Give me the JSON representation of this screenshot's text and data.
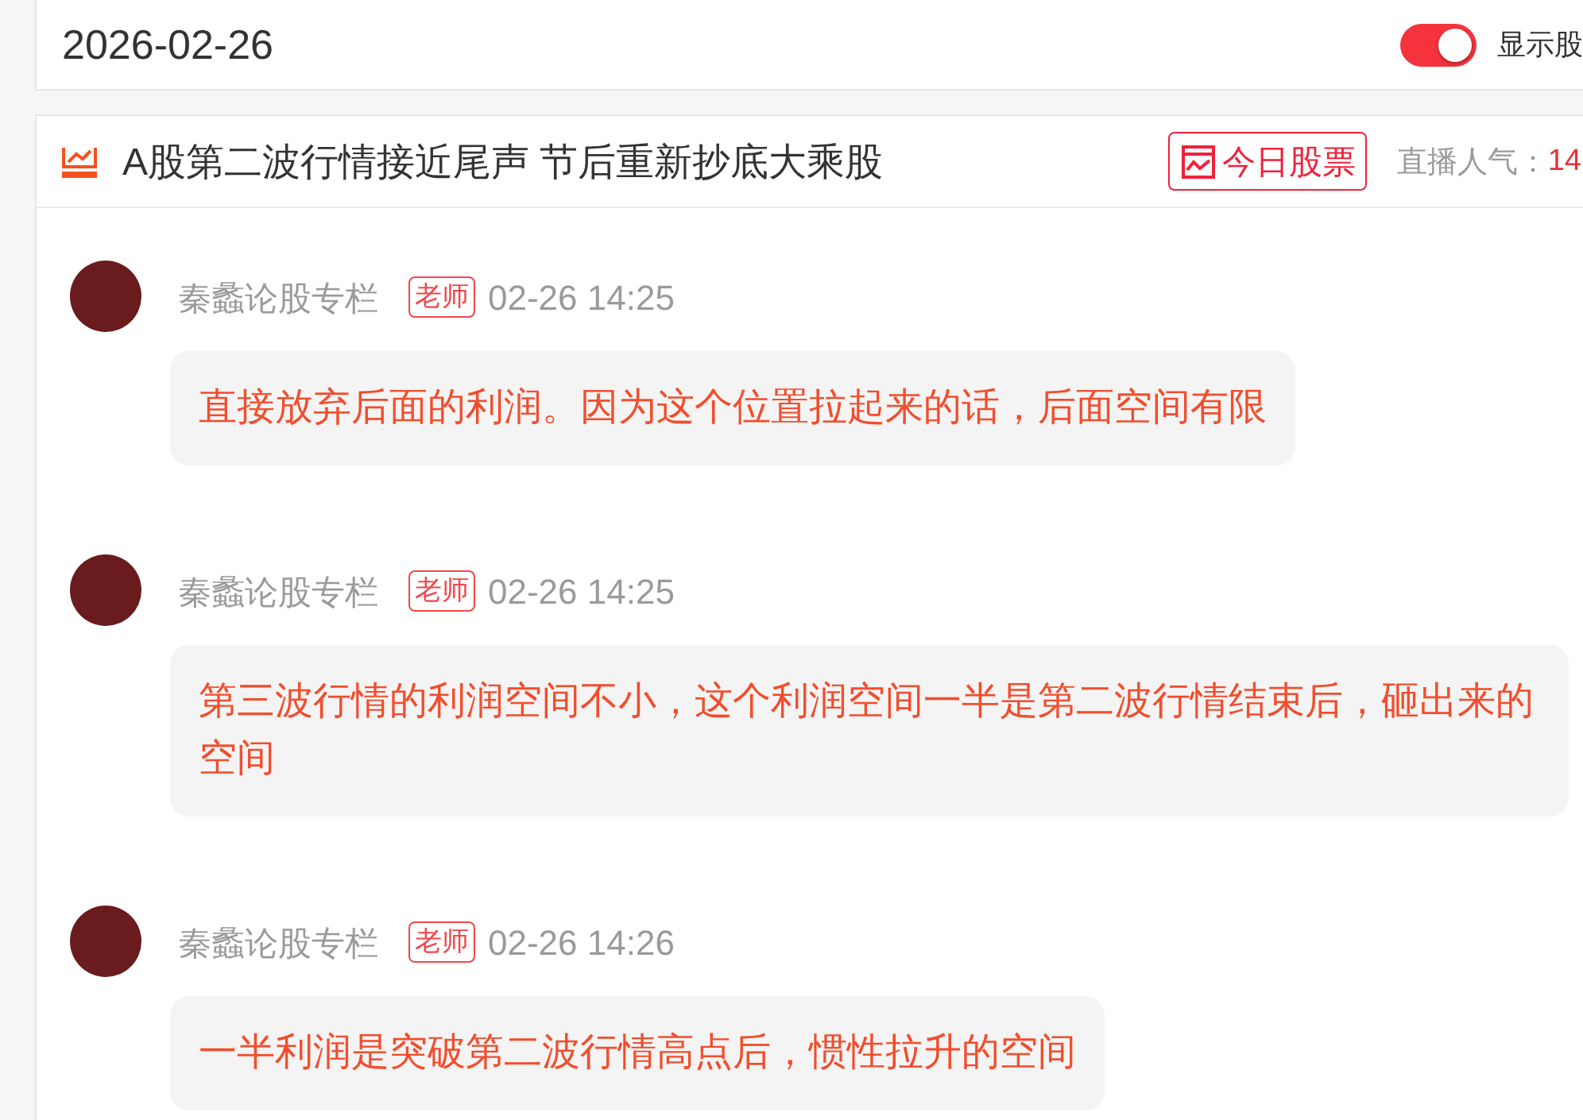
{
  "header": {
    "date": "2026-02-26",
    "toggle": {
      "label": "显示股",
      "on": true
    }
  },
  "live": {
    "title": "A股第二波行情接近尾声 节后重新抄底大乘股",
    "stock_button": "今日股票",
    "popularity_label": "直播人气：",
    "popularity_value": "14"
  },
  "messages": [
    {
      "author": "秦蠡论股专栏",
      "badge": "老师",
      "time": "02-26 14:25",
      "text": "直接放弃后面的利润。因为这个位置拉起来的话，后面空间有限"
    },
    {
      "author": "秦蠡论股专栏",
      "badge": "老师",
      "time": "02-26 14:25",
      "text": "第三波行情的利润空间不小，这个利润空间一半是第二波行情结束后，砸出来的空间"
    },
    {
      "author": "秦蠡论股专栏",
      "badge": "老师",
      "time": "02-26 14:26",
      "text": "一半利润是突破第二波行情高点后，惯性拉升的空间"
    }
  ]
}
